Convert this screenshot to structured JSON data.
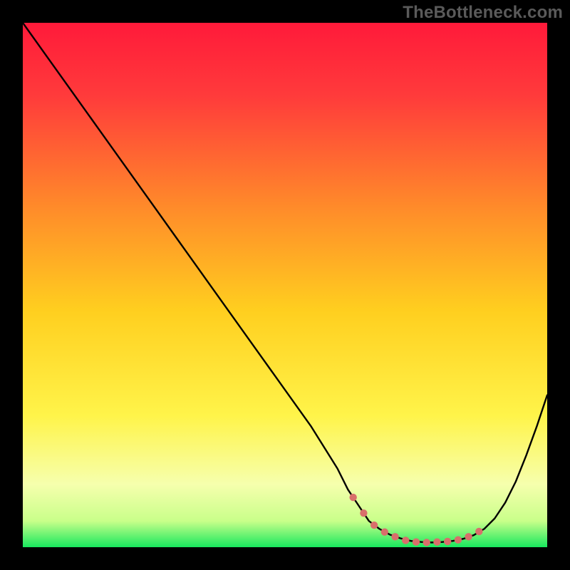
{
  "watermark": "TheBottleneck.com",
  "colors": {
    "frame": "#000000",
    "curve": "#000000",
    "dot_fill": "#d86f6b",
    "gradient_top": "#ff1a3a",
    "gradient_mid": "#ffd900",
    "gradient_low": "#f7ffb0",
    "gradient_bottom": "#18e85e"
  },
  "chart_data": {
    "type": "line",
    "title": "",
    "xlabel": "",
    "ylabel": "",
    "xlim": [
      0,
      100
    ],
    "ylim": [
      0,
      100
    ],
    "series": [
      {
        "name": "curve",
        "x": [
          0,
          5,
          10,
          15,
          20,
          25,
          30,
          35,
          40,
          45,
          50,
          55,
          60,
          62,
          64,
          66,
          68,
          70,
          72,
          74,
          76,
          78,
          80,
          82,
          84,
          86,
          88,
          90,
          92,
          94,
          96,
          98,
          100
        ],
        "y": [
          100,
          93,
          86,
          79,
          72,
          65,
          58,
          51,
          44,
          37,
          30,
          23,
          15,
          11,
          8,
          5,
          3.5,
          2.4,
          1.7,
          1.2,
          1.0,
          0.9,
          1.0,
          1.2,
          1.6,
          2.3,
          3.5,
          5.5,
          8.5,
          12.5,
          17.5,
          23,
          29
        ]
      }
    ],
    "dots": {
      "name": "optimal-range",
      "x": [
        63,
        65,
        67,
        69,
        71,
        73,
        75,
        77,
        79,
        81,
        83,
        85,
        87
      ],
      "y": [
        9.5,
        6.5,
        4.2,
        2.9,
        2.0,
        1.3,
        1.0,
        0.9,
        1.0,
        1.1,
        1.4,
        2.0,
        3.0
      ]
    }
  }
}
